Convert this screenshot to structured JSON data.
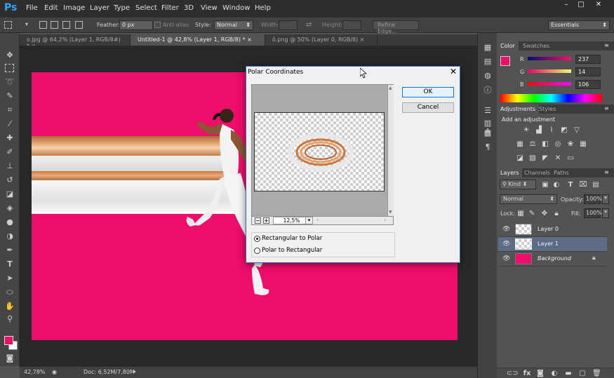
{
  "app": {
    "logo": "Ps"
  },
  "menu": [
    "File",
    "Edit",
    "Image",
    "Layer",
    "Type",
    "Select",
    "Filter",
    "3D",
    "View",
    "Window",
    "Help"
  ],
  "window_controls": {
    "minimize": "–",
    "maximize": "□",
    "close": "✕"
  },
  "options": {
    "feather_label": "Feather:",
    "feather_value": "0 px",
    "antialias_label": "Anti-alias",
    "style_label": "Style:",
    "style_value": "Normal",
    "width_label": "Width:",
    "height_label": "Height:",
    "refine_edge": "Refine Edge...",
    "workspace": "Essentials"
  },
  "tabs": [
    {
      "label": "o.jpg @ 64,2% (Layer 1, RGB/8#) *",
      "close": "×"
    },
    {
      "label": "Untitled-1 @ 42,8% (Layer 1, RGB/8) *",
      "close": "×"
    },
    {
      "label": "ô.png @ 50% (Layer 0, RGB/8)",
      "close": "×"
    }
  ],
  "status": {
    "zoom": "42,78%",
    "doc": "Doc: 6,52M/7,80M"
  },
  "dialog": {
    "title": "Polar Coordinates",
    "ok": "OK",
    "cancel": "Cancel",
    "zoom": "12,5%",
    "option_1": "Rectangular to Polar",
    "option_2": "Polar to Rectangular",
    "selected": "Rectangular to Polar"
  },
  "color_panel": {
    "tabs": [
      "Color",
      "Swatches"
    ],
    "r_label": "R",
    "g_label": "G",
    "b_label": "B",
    "r": "237",
    "g": "14",
    "b": "106",
    "foreground": "#ed0e6a"
  },
  "adjustments": {
    "tabs": [
      "Adjustments",
      "Styles"
    ],
    "heading": "Add an adjustment"
  },
  "layers_panel": {
    "tabs": [
      "Layers",
      "Channels",
      "Paths"
    ],
    "kind": "Kind",
    "blend": "Normal",
    "opacity_label": "Opacity:",
    "opacity": "100%",
    "lock_label": "Lock:",
    "fill_label": "Fill:",
    "fill": "100%",
    "layers": [
      {
        "name": "Layer 0",
        "selected": false
      },
      {
        "name": "Layer 1",
        "selected": true
      },
      {
        "name": "Background",
        "selected": false
      }
    ]
  },
  "colors": {
    "canvas": "#ed0d6b",
    "accent": "#31a8ff"
  }
}
